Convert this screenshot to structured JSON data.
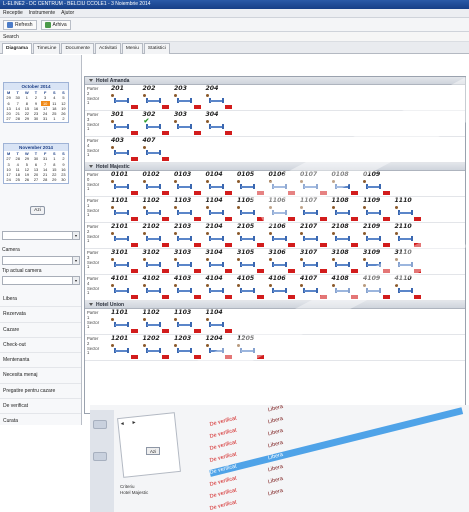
{
  "window": {
    "title": "L-ELINE2 - DC CENTRUM - BELCIU CCOLE1 - 3 Noiembrie 2014"
  },
  "menu": [
    "Receptie",
    "Instrumente",
    "Ajutor"
  ],
  "toolbar": {
    "refresh_label": "Refresh",
    "archive_label": "Arhiva"
  },
  "search": {
    "label": "Search"
  },
  "tabs": [
    "Diagrama",
    "TimeLine",
    "Documente",
    "Activitati",
    "Meniu",
    "Statistici"
  ],
  "sidebar": {
    "calendar1": {
      "title": "October 2014",
      "dow": [
        "M",
        "T",
        "W",
        "T",
        "F",
        "S",
        "S"
      ],
      "days": [
        "29",
        "30",
        "1",
        "2",
        "3",
        "4",
        "5",
        "6",
        "7",
        "8",
        "9",
        "10",
        "11",
        "12",
        "13",
        "14",
        "15",
        "16",
        "17",
        "18",
        "19",
        "20",
        "21",
        "22",
        "23",
        "24",
        "25",
        "26",
        "27",
        "28",
        "29",
        "30",
        "31",
        "1",
        "2"
      ],
      "selected_index": 11
    },
    "calendar2": {
      "title": "November 2014",
      "dow": [
        "M",
        "T",
        "W",
        "T",
        "F",
        "S",
        "S"
      ],
      "days": [
        "27",
        "28",
        "29",
        "30",
        "31",
        "1",
        "2",
        "3",
        "4",
        "5",
        "6",
        "7",
        "8",
        "9",
        "10",
        "11",
        "12",
        "13",
        "14",
        "15",
        "16",
        "17",
        "18",
        "19",
        "20",
        "21",
        "22",
        "23",
        "24",
        "25",
        "26",
        "27",
        "28",
        "29",
        "30"
      ]
    },
    "today_button": "Azi",
    "camera_label": "Camera",
    "actual_label": "Tip actual camera",
    "status_items": [
      "Libera",
      "Rezervata",
      "Cazare",
      "Check-out",
      "Mentenanta",
      "Necesita menaj",
      "Pregatire pentru cazare",
      "De verificat",
      "Curata",
      "Pregatire pentru cazare"
    ]
  },
  "hotels": [
    {
      "name": "Hotel Amanda",
      "floors": [
        {
          "label": "Parter\n2\nSector\n1",
          "rooms": [
            "201",
            "202",
            "203",
            "204"
          ]
        },
        {
          "label": "Parter\n3\nSector\n1",
          "rooms": [
            "301",
            "302",
            "303",
            "304"
          ]
        },
        {
          "label": "Parter\n4\nSector\n1",
          "rooms": [
            "403",
            "407"
          ]
        }
      ]
    },
    {
      "name": "Hotel Majestic",
      "floors": [
        {
          "label": "Parter\n0\nSector\n1",
          "rooms": [
            "0101",
            "0102",
            "0103",
            "0104",
            "0105",
            "0106",
            "0107",
            "0108",
            "0109"
          ]
        },
        {
          "label": "Parter\n1\nSector\n1",
          "rooms": [
            "1101",
            "1102",
            "1103",
            "1104",
            "1105",
            "1106",
            "1107",
            "1108",
            "1109",
            "1110"
          ]
        },
        {
          "label": "Parter\n2\nSector\n1",
          "rooms": [
            "2101",
            "2102",
            "2103",
            "2104",
            "2105",
            "2106",
            "2107",
            "2108",
            "2109",
            "2110"
          ]
        },
        {
          "label": "Parter\n3\nSector\n1",
          "rooms": [
            "3101",
            "3102",
            "3103",
            "3104",
            "3105",
            "3106",
            "3107",
            "3108",
            "3109",
            "3110"
          ]
        },
        {
          "label": "Parter\n4\nSector\n1",
          "rooms": [
            "4101",
            "4102",
            "4103",
            "4104",
            "4105",
            "4106",
            "4107",
            "4108",
            "4109",
            "4110"
          ]
        }
      ]
    },
    {
      "name": "Hotel Union",
      "floors": [
        {
          "label": "Parter\n1\nSector\n1",
          "rooms": [
            "1101",
            "1102",
            "1103",
            "1104"
          ]
        },
        {
          "label": "Parter\n2\nSector\n1",
          "rooms": [
            "1201",
            "1202",
            "1203",
            "1204",
            "1205"
          ]
        }
      ]
    }
  ],
  "background_window": {
    "today_button": "Azi",
    "criteria_label": "Criteriu",
    "criteria_value": "Hotel Majestic",
    "rows": [
      {
        "a": "De verificat",
        "b": "Libera"
      },
      {
        "a": "De verificat",
        "b": "Libera"
      },
      {
        "a": "De verificat",
        "b": "Libera"
      },
      {
        "a": "De verificat",
        "b": "Libera"
      },
      {
        "a": "De verificat",
        "b": "Libera"
      },
      {
        "a": "De verificat",
        "b": "Libera"
      },
      {
        "a": "De verificat",
        "b": "Libera"
      },
      {
        "a": "De verificat",
        "b": "Libera"
      }
    ]
  },
  "colors": {
    "accent": "#3a67b0",
    "selected_day": "#f08a18",
    "flag": "#d21c1c",
    "highlight_row": "#4fa3e8"
  }
}
